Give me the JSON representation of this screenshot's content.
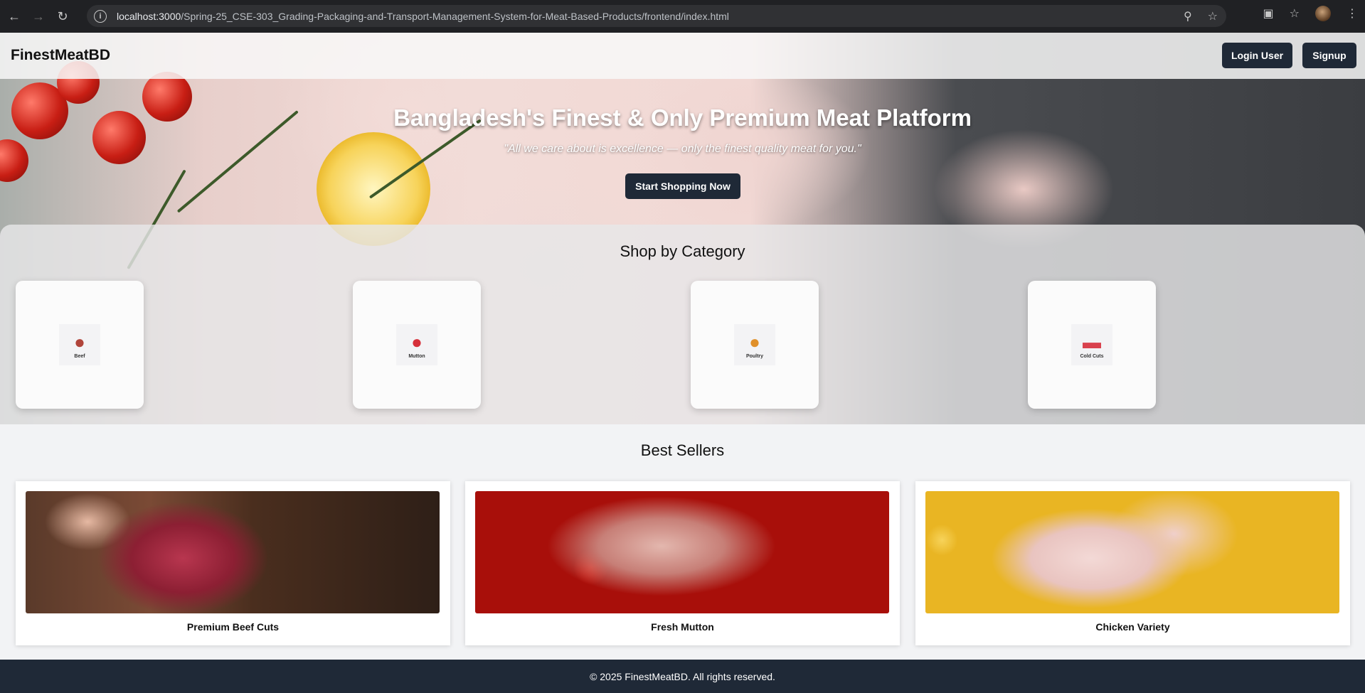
{
  "browser": {
    "url_host": "localhost:3000",
    "url_path": "/Spring-25_CSE-303_Grading-Packaging-and-Transport-Management-System-for-Meat-Based-Products/frontend/index.html",
    "icons": [
      "back-icon",
      "forward-icon",
      "reload-icon",
      "site-info-icon",
      "zoom-icon",
      "bookmark-star-icon",
      "extensions-icon",
      "bookmarks-icon",
      "profile-avatar",
      "menu-icon"
    ]
  },
  "header": {
    "brand": "FinestMeatBD",
    "login_label": "Login User",
    "signup_label": "Signup"
  },
  "hero": {
    "title": "Bangladesh's Finest & Only Premium Meat Platform",
    "quote": "\"All we care about is excellence — only the finest quality meat for you.\"",
    "cta_label": "Start Shopping Now"
  },
  "categories": {
    "title": "Shop by Category",
    "items": [
      {
        "label": "Beef",
        "icon": "steak-icon"
      },
      {
        "label": "Mutton",
        "icon": "mutton-icon"
      },
      {
        "label": "Poultry",
        "icon": "roast-chicken-icon"
      },
      {
        "label": "Cold Cuts",
        "icon": "sausage-icon"
      }
    ]
  },
  "best_sellers": {
    "title": "Best Sellers",
    "items": [
      {
        "name": "Premium Beef Cuts"
      },
      {
        "name": "Fresh Mutton"
      },
      {
        "name": "Chicken Variety"
      }
    ]
  },
  "footer": {
    "text": "© 2025 FinestMeatBD. All rights reserved."
  },
  "colors": {
    "primary_button": "#1f2937",
    "footer": "#1f2937",
    "page_bg": "#f2f3f5"
  }
}
